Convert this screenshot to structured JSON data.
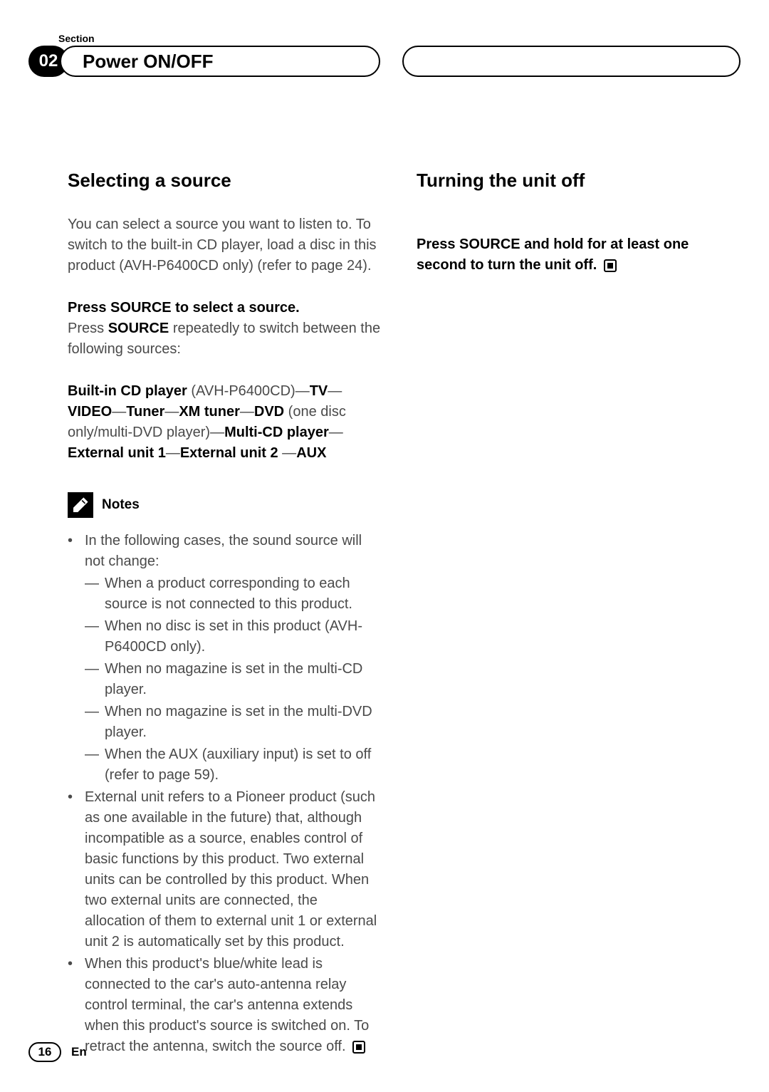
{
  "header": {
    "section_label": "Section",
    "section_number": "02",
    "title": "Power ON/OFF"
  },
  "left_column": {
    "heading": "Selecting a source",
    "intro": "You can select a source you want to listen to. To switch to the built-in CD player, load a disc in this product (AVH-P6400CD only) (refer to page 24).",
    "instruction_title": "Press SOURCE to select a source.",
    "instruction_body_pre": "Press ",
    "instruction_body_bold": "SOURCE",
    "instruction_body_post": " repeatedly to switch between the following sources:",
    "sources": {
      "s1": "Built-in CD player",
      "s1_paren": " (AVH-P6400CD)—",
      "s2": "TV",
      "dash1": "—",
      "s3": "VIDEO",
      "dash2": "—",
      "s4": "Tuner",
      "dash3": "—",
      "s5": "XM tuner",
      "dash4": "—",
      "s6": "DVD",
      "s6_paren": " (one disc only/multi-DVD player)—",
      "s7": "Multi-CD player",
      "dash5": "—",
      "s8": "External unit 1",
      "dash6": "—",
      "s9": "External unit 2",
      "dash7": " —",
      "s10": "AUX"
    },
    "notes_label": "Notes",
    "notes": {
      "n1": "In the following cases, the sound source will not change:",
      "n1a": "When a product corresponding to each source is not connected to this product.",
      "n1b": "When no disc is set in this product (AVH-P6400CD only).",
      "n1c": "When no magazine is set in the multi-CD player.",
      "n1d": "When no magazine is set in the multi-DVD player.",
      "n1e": "When the AUX (auxiliary input) is set to off (refer to page 59).",
      "n2": "External unit refers to a Pioneer product (such as one available in the future) that, although incompatible as a source, enables control of basic functions by this product. Two external units can be controlled by this product. When two external units are connected, the allocation of them to external unit 1 or external unit 2 is automatically set by this product.",
      "n3": "When this product's blue/white lead is connected to the car's auto-antenna relay control terminal, the car's antenna extends when this product's source is switched on. To retract the antenna, switch the source off."
    }
  },
  "right_column": {
    "heading": "Turning the unit off",
    "instruction": "Press SOURCE and hold for at least one second to turn the unit off."
  },
  "footer": {
    "page": "16",
    "lang": "En"
  }
}
